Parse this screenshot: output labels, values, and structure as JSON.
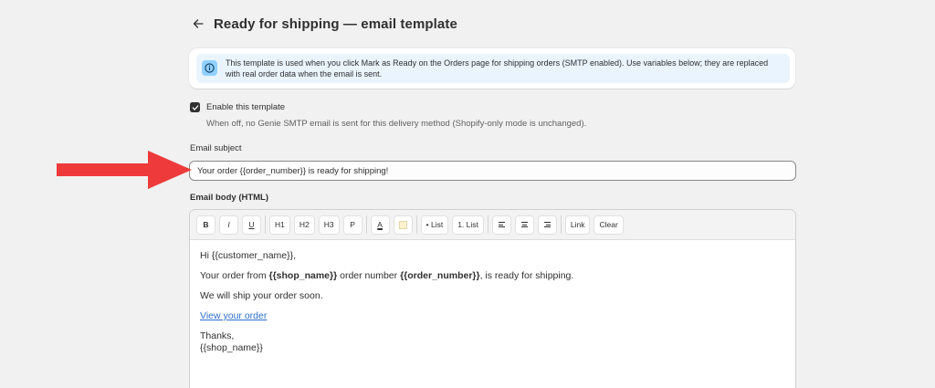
{
  "header": {
    "title": "Ready for shipping — email template",
    "back_icon": "arrow-left-icon"
  },
  "banner": {
    "icon": "info-icon",
    "text": "This template is used when you click Mark as Ready on the Orders page for shipping orders (SMTP enabled). Use variables below; they are replaced with real order data when the email is sent."
  },
  "enable": {
    "checked": true,
    "label": "Enable this template",
    "help": "When off, no Genie SMTP email is sent for this delivery method (Shopify-only mode is unchanged)."
  },
  "subject": {
    "label": "Email subject",
    "value": "Your order {{order_number}} is ready for shipping!"
  },
  "body": {
    "label": "Email body (HTML)",
    "toolbar": {
      "bold": "B",
      "italic": "I",
      "underline": "U",
      "h1": "H1",
      "h2": "H2",
      "h3": "H3",
      "paragraph": "P",
      "text_color": "A",
      "highlight_swatch_color": "#fff3cf",
      "bullet_list": "• List",
      "numbered_list": "1. List",
      "link": "Link",
      "clear": "Clear"
    },
    "content": {
      "greeting": "Hi {{customer_name}},",
      "line1_prefix": "Your order from ",
      "line1_shop": "{{shop_name}}",
      "line1_mid": " order number ",
      "line1_order": "{{order_number}}",
      "line1_suffix": ", is ready for shipping.",
      "line2": "We will ship your order soon.",
      "link_text": "View your order",
      "closing": "Thanks,",
      "signature": "{{shop_name}}"
    }
  },
  "colors": {
    "arrow": "#ee3a3a",
    "banner_bg": "#eaf4ff",
    "banner_icon_bg": "#91d0ff",
    "link": "#2c6ecb"
  }
}
